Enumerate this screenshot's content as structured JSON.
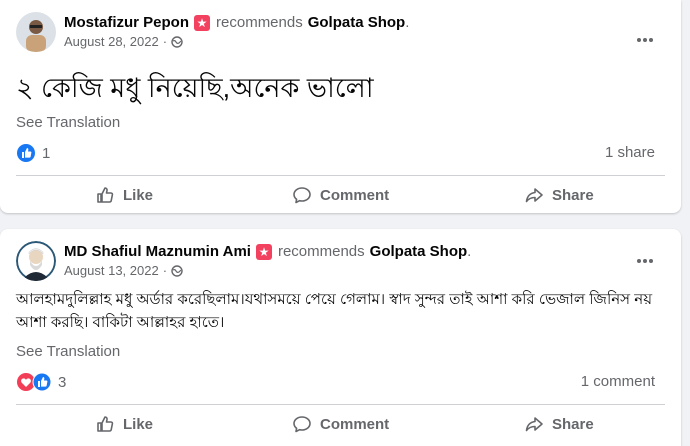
{
  "posts": [
    {
      "author": "Mostafizur Pepon",
      "recommends_text": "recommends",
      "page": "Golpata Shop",
      "date": "August 28, 2022",
      "separator": "·",
      "body": "২ কেজি মধু নিয়েছি,অনেক ভালো",
      "see_translation": "See Translation",
      "reaction_count": "1",
      "right_stat": "1 share",
      "actions": {
        "like": "Like",
        "comment": "Comment",
        "share": "Share"
      }
    },
    {
      "author": "MD Shafiul Maznumin Ami",
      "recommends_text": "recommends",
      "page": "Golpata Shop",
      "date": "August 13, 2022",
      "separator": "·",
      "body": "আলহামদুলিল্লাহ মধু অর্ডার করেছিলাম।যথাসময়ে পেয়ে গেলাম। স্বাদ সুন্দর তাই আশা করি ভেজাল জিনিস নয় আশা করছি। বাকিটা আল্লাহর হাতে।",
      "see_translation": "See Translation",
      "reaction_count": "3",
      "right_stat": "1 comment",
      "actions": {
        "like": "Like",
        "comment": "Comment",
        "share": "Share"
      }
    }
  ],
  "colors": {
    "like_blue": "#1877f2",
    "love_red": "#f33e58",
    "recommend_badge": "#f3425f",
    "secondary_text": "#65676b"
  }
}
